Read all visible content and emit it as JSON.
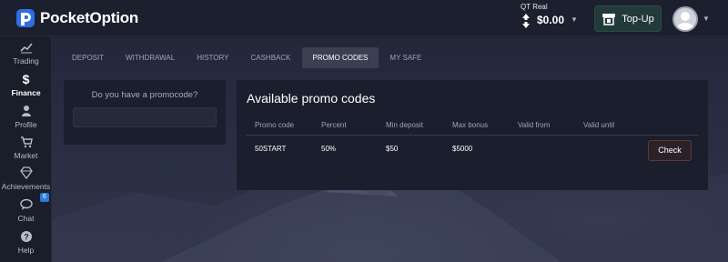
{
  "brand": {
    "name": "PocketOption"
  },
  "header": {
    "account_type": "QT Real",
    "balance": "$0.00",
    "topup_label": "Top-Up"
  },
  "sidebar": {
    "items": [
      {
        "label": "Trading",
        "icon": "chart-icon"
      },
      {
        "label": "Finance",
        "icon": "dollar-icon",
        "active": true
      },
      {
        "label": "Profile",
        "icon": "user-icon"
      },
      {
        "label": "Market",
        "icon": "cart-icon"
      },
      {
        "label": "Achievements",
        "icon": "diamond-icon"
      },
      {
        "label": "Chat",
        "icon": "chat-icon",
        "badge": "6"
      },
      {
        "label": "Help",
        "icon": "help-icon"
      }
    ]
  },
  "tabs": [
    {
      "label": "DEPOSIT"
    },
    {
      "label": "WITHDRAWAL"
    },
    {
      "label": "HISTORY"
    },
    {
      "label": "CASHBACK"
    },
    {
      "label": "PROMO CODES",
      "active": true
    },
    {
      "label": "MY SAFE"
    }
  ],
  "promo_input": {
    "question": "Do you have a promocode?",
    "value": ""
  },
  "promo_codes": {
    "title": "Available promo codes",
    "columns": [
      "Promo code",
      "Percent",
      "Min deposit",
      "Max bonus",
      "Valid from",
      "Valid until"
    ],
    "rows": [
      {
        "code": "50START",
        "percent": "50%",
        "min_deposit": "$50",
        "max_bonus": "$5000",
        "valid_from": "",
        "valid_until": "",
        "action": "Check"
      }
    ]
  },
  "colors": {
    "accent_blue": "#2a7ad6",
    "topup_bg": "#223a3a",
    "panel_bg": "#1b1e2c",
    "check_border": "#5a3a3a"
  }
}
